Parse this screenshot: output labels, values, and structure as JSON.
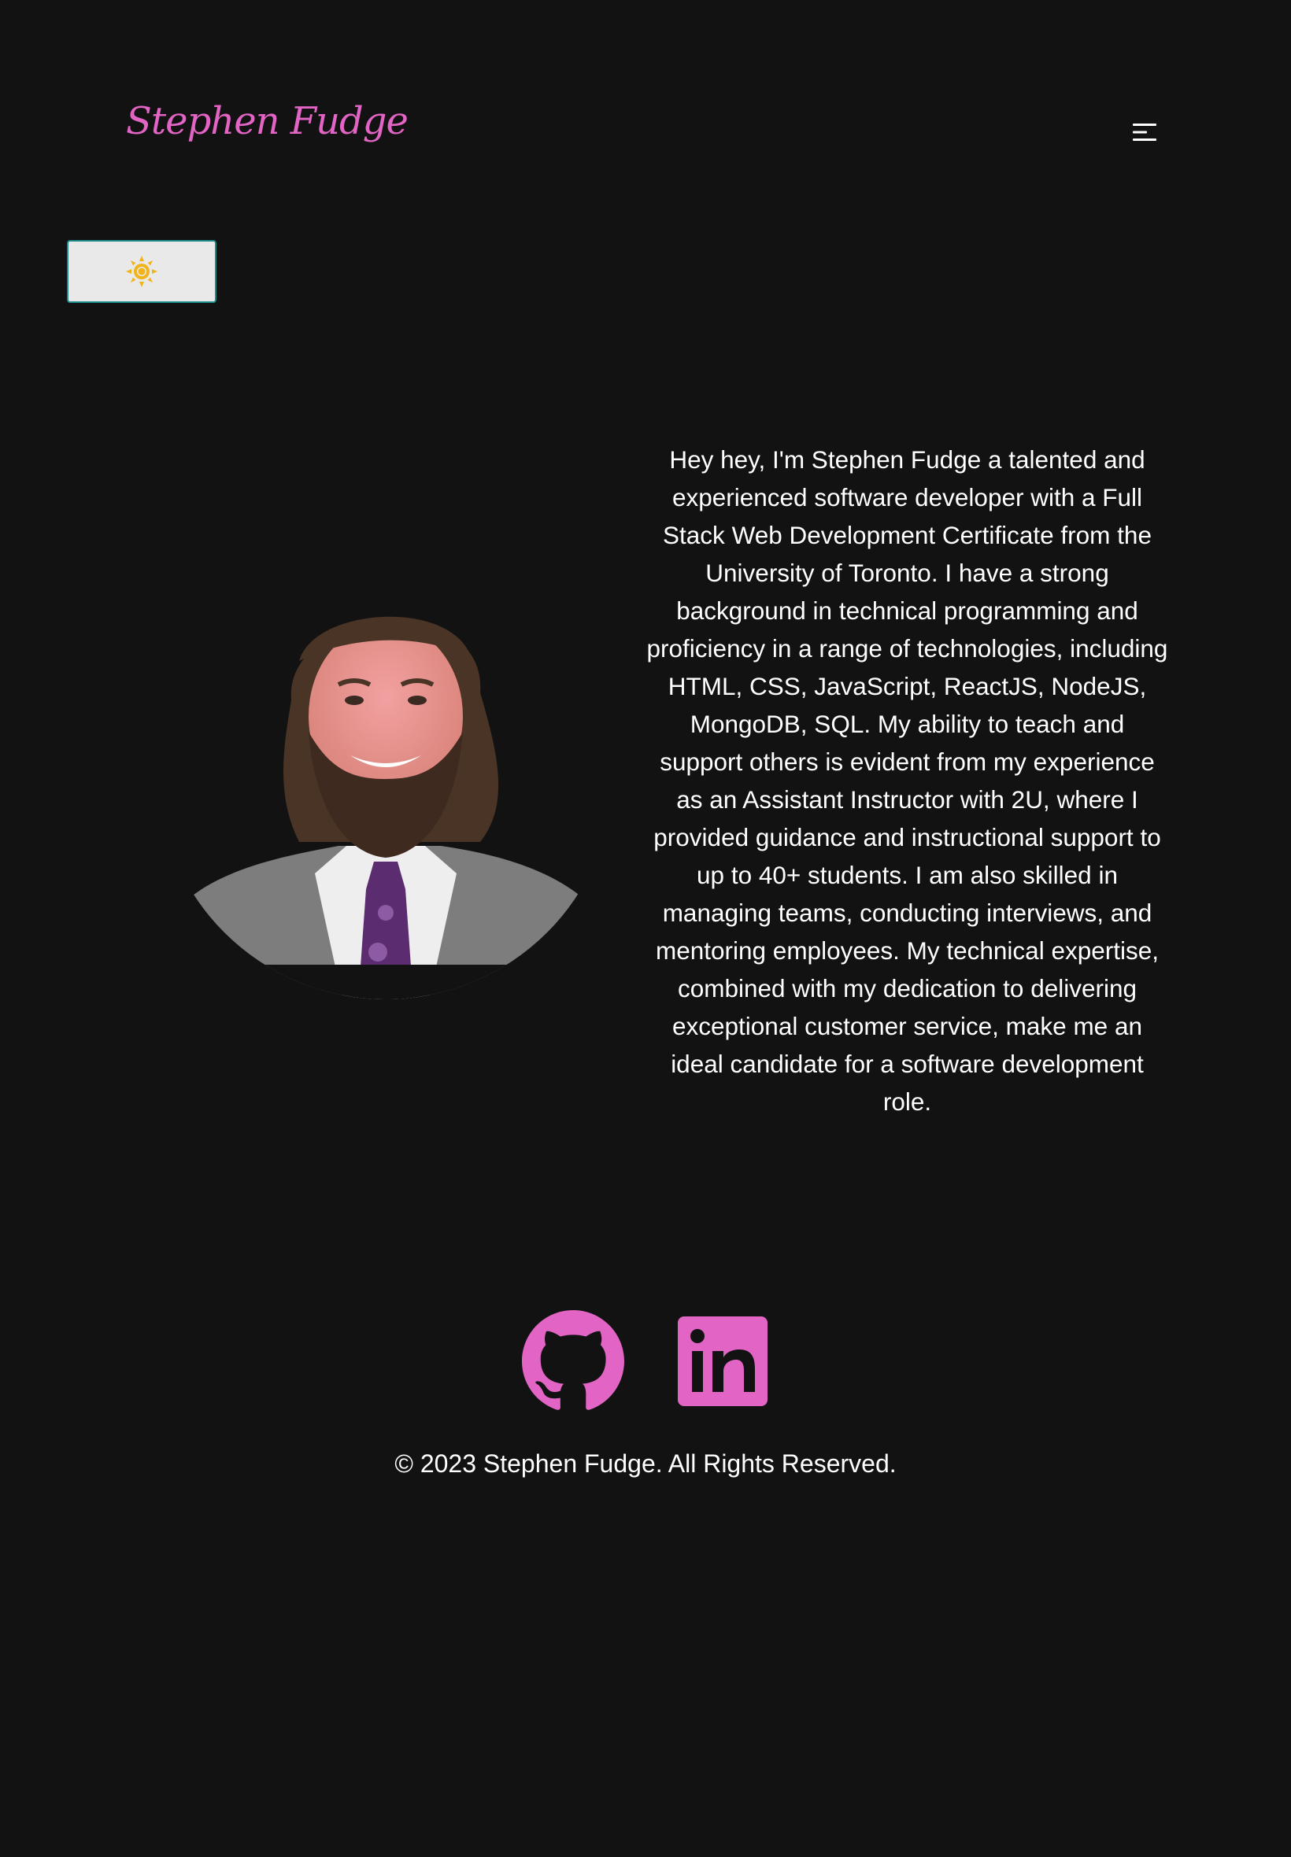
{
  "header": {
    "brand": "Stephen Fudge",
    "menu_icon": "hamburger-menu-icon"
  },
  "theme_toggle": {
    "icon": "sun-icon",
    "sun_color": "#f1b418"
  },
  "about": {
    "portrait_alt": "Stephen Fudge",
    "bio": "Hey hey, I'm Stephen Fudge a talented and experienced software developer with a Full Stack Web Development Certificate from the University of Toronto. I have a strong background in technical programming and proficiency in a range of technologies, including HTML, CSS, JavaScript, ReactJS, NodeJS, MongoDB, SQL. My ability to teach and support others is evident from my experience as an Assistant Instructor with 2U, where I provided guidance and instructional support to up to 40+ students. I am also skilled in managing teams, conducting interviews, and mentoring employees. My technical expertise, combined with my dedication to delivering exceptional customer service, make me an ideal candidate for a software development role."
  },
  "footer": {
    "social_icons": [
      "github-icon",
      "linkedin-icon"
    ],
    "copyright": "© 2023 Stephen Fudge. All Rights Reserved."
  },
  "colors": {
    "background": "#121212",
    "accent": "#e264c4",
    "text": "#ffffff",
    "toggle_border": "#1c8b8c"
  }
}
